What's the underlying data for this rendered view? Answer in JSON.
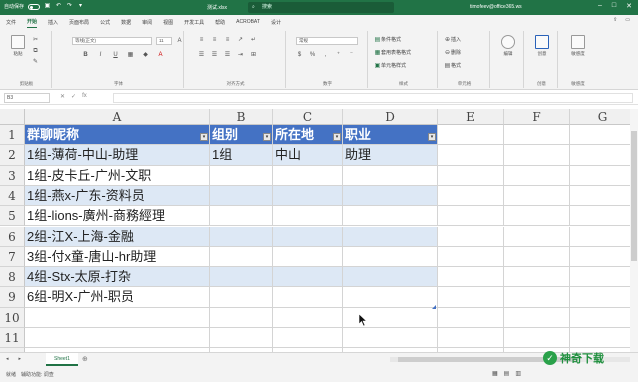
{
  "titlebar": {
    "autosave_label": "自动保存",
    "filename": "测试.xlsx",
    "search_placeholder": "搜索",
    "account": "timofeev@office365.ws"
  },
  "tabs": [
    "文件",
    "开始",
    "插入",
    "页面布局",
    "公式",
    "数据",
    "审阅",
    "视图",
    "开发工具",
    "帮助",
    "ACROBAT",
    "设计"
  ],
  "active_tab": "开始",
  "ribbon": {
    "clipboard": {
      "paste": "粘贴",
      "label": "剪贴板"
    },
    "font": {
      "name": "等线(正文)",
      "size": "11",
      "label": "字体"
    },
    "alignment": {
      "label": "对齐方式"
    },
    "number": {
      "format": "常规",
      "label": "数字"
    },
    "styles": {
      "conditional": "条件格式",
      "table": "套用表格格式",
      "cell": "单元格样式",
      "label": "样式"
    },
    "cells": {
      "insert": "插入",
      "delete": "删除",
      "format": "格式",
      "label": "单元格"
    },
    "editing": {
      "button": "编辑",
      "label": ""
    },
    "ideas": {
      "button": "创意",
      "label": "创意"
    },
    "sensitivity": {
      "button": "敏感度",
      "label": "敏感度"
    }
  },
  "formula_bar": {
    "name_box": "B3",
    "fx": "fx",
    "value": ""
  },
  "columns": [
    "A",
    "B",
    "C",
    "D",
    "E",
    "F",
    "G"
  ],
  "rows": [
    "1",
    "2",
    "3",
    "4",
    "5",
    "6",
    "7",
    "8",
    "9",
    "10",
    "11",
    "12"
  ],
  "table": {
    "headers": [
      "群聊昵称",
      "组别",
      "所在地",
      "职业"
    ],
    "rows": [
      [
        "1组-薄荷-中山-助理",
        "1组",
        "中山",
        "助理"
      ],
      [
        "1组-皮卡丘-广州-文职",
        "",
        "",
        ""
      ],
      [
        "1组-燕x-广东-资料员",
        "",
        "",
        ""
      ],
      [
        "1组-lions-廣州-商務經理",
        "",
        "",
        ""
      ],
      [
        "2组-江X-上海-金融",
        "",
        "",
        ""
      ],
      [
        "3组-付x童-唐山-hr助理",
        "",
        "",
        ""
      ],
      [
        "4组-Stx-太原-打杂",
        "",
        "",
        ""
      ],
      [
        "6组-明X-广州-职员",
        "",
        "",
        ""
      ]
    ]
  },
  "sheet_tab": "Sheet1",
  "status": {
    "mode": "就绪",
    "accessibility": "辅助功能: 调查"
  },
  "watermark": "神奇下载"
}
